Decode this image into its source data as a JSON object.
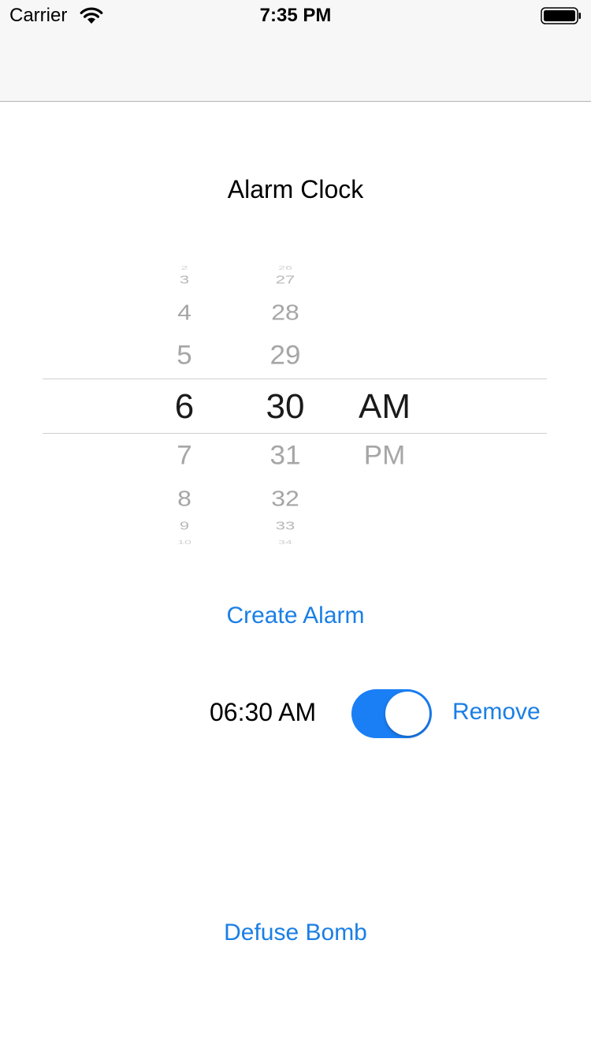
{
  "status_bar": {
    "carrier": "Carrier",
    "time": "7:35 PM",
    "icons": [
      "wifi-icon",
      "battery-icon"
    ]
  },
  "title": "Alarm Clock",
  "picker": {
    "hours": {
      "m3": "2",
      "m2": "3",
      "m1": "4",
      "r0": "5",
      "selected": "6",
      "p1": "7",
      "p2": "8",
      "p3": "9",
      "p4": "10"
    },
    "minutes": {
      "m3": "26",
      "m2": "27",
      "m1": "28",
      "r0": "29",
      "selected": "30",
      "p1": "31",
      "p2": "32",
      "p3": "33",
      "p4": "34"
    },
    "ampm": {
      "selected": "AM",
      "p1": "PM"
    }
  },
  "create_alarm_label": "Create Alarm",
  "alarm": {
    "time": "06:30 AM",
    "enabled": true,
    "remove_label": "Remove"
  },
  "defuse_label": "Defuse Bomb",
  "colors": {
    "accent": "#1a7fe5",
    "toggle_on": "#1a7ff5",
    "bar_background": "#f7f7f7"
  }
}
